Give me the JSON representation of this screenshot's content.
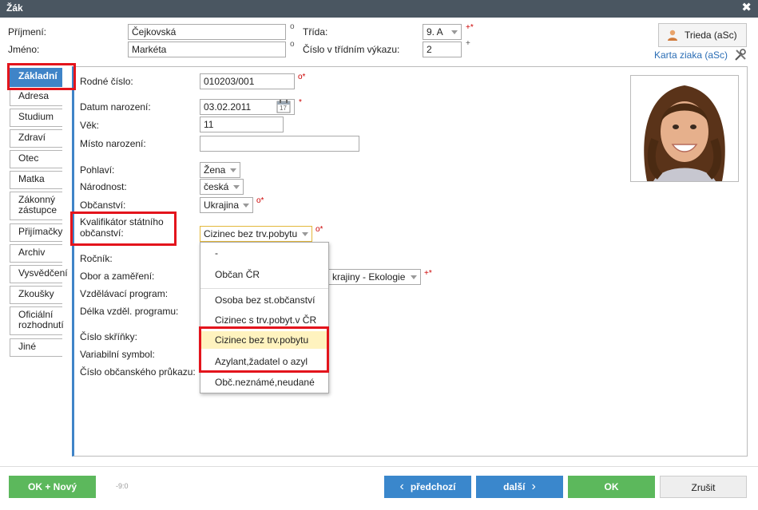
{
  "window": {
    "title": "Žák",
    "close_glyph": "✖"
  },
  "header": {
    "surname_label": "Příjmení:",
    "surname_value": "Čejkovská",
    "name_label": "Jméno:",
    "name_value": "Markéta",
    "class_label": "Třída:",
    "class_value": "9. A",
    "classnum_label": "Číslo v třídním výkazu:",
    "classnum_value": "2",
    "trieda_button": "Trieda (aSc)",
    "karta_link": "Karta ziaka (aSc)"
  },
  "markers": {
    "ring": "o",
    "req": "*",
    "ring_req": "o*",
    "plus_req": "+*",
    "plus": "+"
  },
  "tabs": [
    {
      "label": "Základní",
      "active": true
    },
    {
      "label": "Adresa"
    },
    {
      "label": "Studium"
    },
    {
      "label": "Zdraví"
    },
    {
      "label": "Otec"
    },
    {
      "label": "Matka"
    },
    {
      "label": "Zákonný zástupce"
    },
    {
      "label": "Přijímačky"
    },
    {
      "label": "Archiv"
    },
    {
      "label": "Vysvědčení"
    },
    {
      "label": "Zkoušky"
    },
    {
      "label": "Oficiální rozhodnutí"
    },
    {
      "label": "Jiné"
    }
  ],
  "form": {
    "rodne_cislo_label": "Rodné číslo:",
    "rodne_cislo_value": "010203/001",
    "datum_label": "Datum narození:",
    "datum_value": "03.02.2011",
    "calendar_day": "17",
    "vek_label": "Věk:",
    "vek_value": "11",
    "misto_label": "Místo narození:",
    "misto_value": "",
    "pohlavi_label": "Pohlaví:",
    "pohlavi_value": "Žena",
    "narodnost_label": "Národnost:",
    "narodnost_value": "česká",
    "obcanstvi_label": "Občanství:",
    "obcanstvi_value": "Ukrajina",
    "kvalifikator_label": "Kvalifikátor státního občanství:",
    "kvalifikator_value": "Cizinec bez trv.pobytu",
    "rocnik_label": "Ročník:",
    "obor_label": "Obor a zaměření:",
    "obor_value": "krajiny - Ekologie",
    "program_label": "Vzdělávací program:",
    "delka_label": "Délka vzděl. programu:",
    "skrinka_label": "Číslo skříňky:",
    "variabilni_label": "Variabilní symbol:",
    "prukaz_label": "Číslo občanského průkazu:"
  },
  "dropdown": {
    "options": [
      "-",
      "Občan ČR",
      "Osoba bez st.občanství",
      "Cizinec s trv.pobyt.v ČR",
      "Cizinec bez trv.pobytu",
      "Azylant,žadatel o azyl",
      "Obč.neznámé,neudané"
    ],
    "selected": "Cizinec bez trv.pobytu"
  },
  "footer": {
    "ok_new": "OK + Nový",
    "counter": "-9:0",
    "prev": "předchozí",
    "next": "další",
    "ok": "OK",
    "cancel": "Zrušit"
  },
  "colors": {
    "accent": "#3f84c8",
    "green": "#5cb85c",
    "titlebar": "#4a5661",
    "highlight": "#e3141c"
  }
}
